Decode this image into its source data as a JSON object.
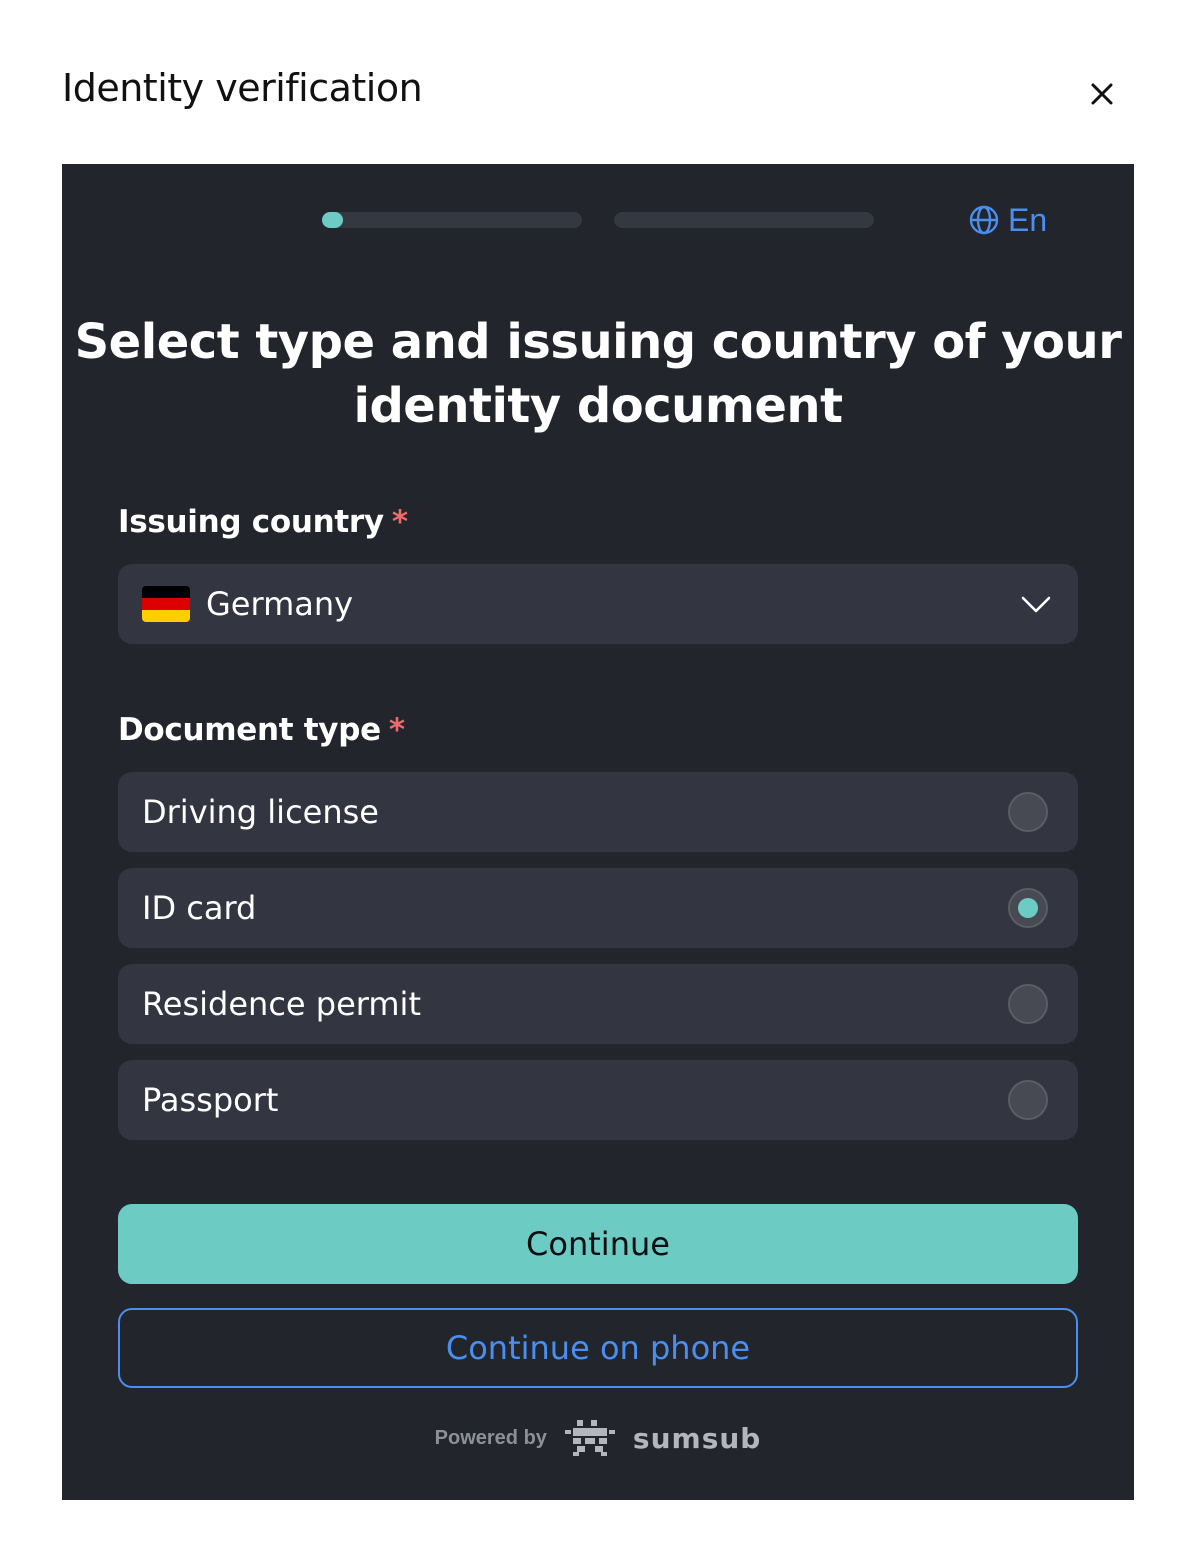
{
  "modal": {
    "title": "Identity verification"
  },
  "progress": {
    "steps": [
      {
        "fraction": 0.08
      },
      {
        "fraction": 0.0
      }
    ]
  },
  "language": {
    "label": "En",
    "icon": "globe-icon"
  },
  "heading": {
    "line1": "Select type and issuing country of your",
    "line2": "identity document"
  },
  "issuing_country": {
    "label": "Issuing country",
    "required_mark": "*",
    "selected": "Germany",
    "flag_colors": [
      "#000000",
      "#dd0000",
      "#ffce00"
    ]
  },
  "document_type": {
    "label": "Document type",
    "required_mark": "*",
    "options": [
      {
        "label": "Driving license",
        "selected": false
      },
      {
        "label": "ID card",
        "selected": true
      },
      {
        "label": "Residence permit",
        "selected": false
      },
      {
        "label": "Passport",
        "selected": false
      }
    ]
  },
  "actions": {
    "continue": "Continue",
    "continue_on_phone": "Continue on phone"
  },
  "footer": {
    "powered_by": "Powered by",
    "brand": "sumsub"
  },
  "colors": {
    "panel_bg": "#22252c",
    "accent_teal": "#6ccbc3",
    "link_blue": "#4a8ff0",
    "required_red": "#ef6a6a"
  }
}
